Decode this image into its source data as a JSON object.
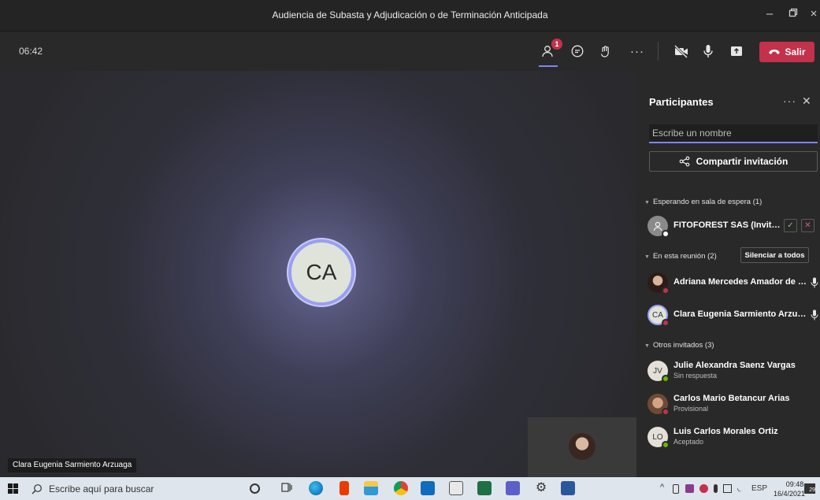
{
  "window": {
    "title": "Audiencia de Subasta y Adjudicación o de Terminación Anticipada",
    "minimize_icon": "minimize-icon",
    "maximize_icon": "maximize-icon",
    "close_icon": "close-icon"
  },
  "controls": {
    "timer": "06:42",
    "participants_badge": "1",
    "leave_label": "Salir",
    "accent": "#7f85f5",
    "leave_color": "#c4314b"
  },
  "stage": {
    "initials": "CA",
    "speaker_name": "Clara Eugenia Sarmiento Arzuaga"
  },
  "panel": {
    "title": "Participantes",
    "search_placeholder": "Escribe un nombre",
    "share_label": "Compartir invitación",
    "lobby_section": "Esperando en sala de espera (1)",
    "meeting_section": "En esta reunión (2)",
    "mute_all_label": "Silenciar a todos",
    "others_section": "Otros invitados (3)",
    "lobby": [
      {
        "name": "FITOFOREST SAS (Invitado)"
      }
    ],
    "in_meeting": [
      {
        "name": "Adriana Mercedes Amador de Vi...",
        "initials": ""
      },
      {
        "name": "Clara Eugenia Sarmiento Arzua...",
        "initials": "CA"
      }
    ],
    "others": [
      {
        "name": "Julie Alexandra Saenz Vargas",
        "status": "Sin respuesta",
        "initials": "JV"
      },
      {
        "name": "Carlos Mario Betancur Arias",
        "status": "Provisional",
        "initials": ""
      },
      {
        "name": "Luis Carlos Morales Ortiz",
        "status": "Aceptado",
        "initials": "LO"
      }
    ]
  },
  "taskbar": {
    "search_placeholder": "Escribe aquí para buscar",
    "language": "ESP",
    "time": "09:48",
    "date": "16/4/2021",
    "notification_count": "29"
  }
}
